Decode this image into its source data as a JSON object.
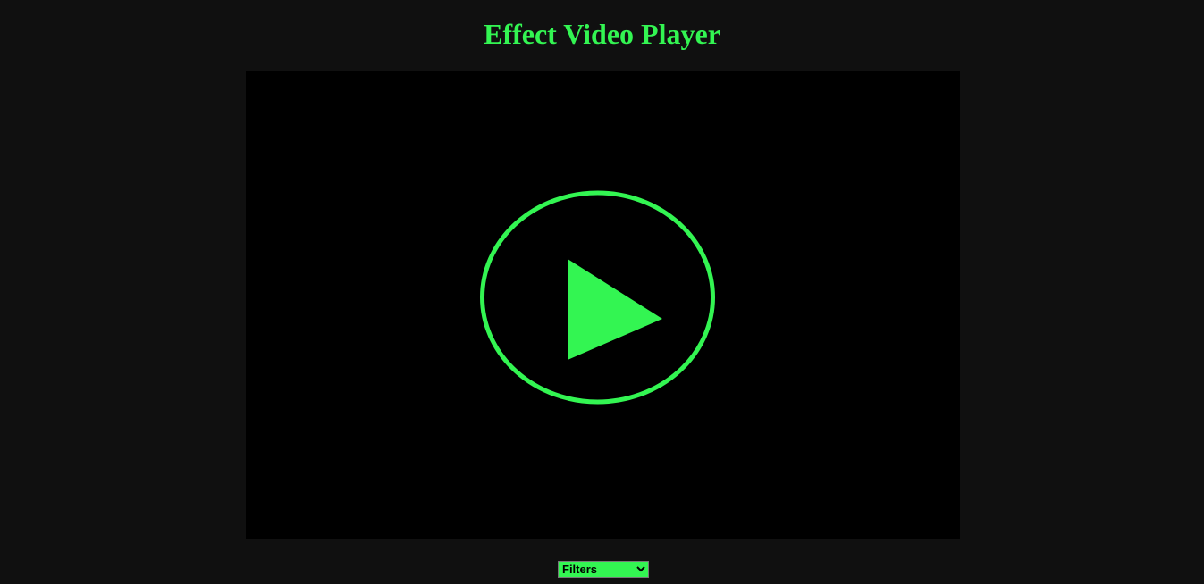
{
  "page": {
    "title": "Effect Video Player"
  },
  "player": {
    "play_icon": "play-circle-icon"
  },
  "filters": {
    "selected_label": "Filters",
    "chevron_icon": "chevron-down-icon"
  },
  "colors": {
    "accent": "#33f552",
    "background": "#101010",
    "video_background": "#000000"
  }
}
